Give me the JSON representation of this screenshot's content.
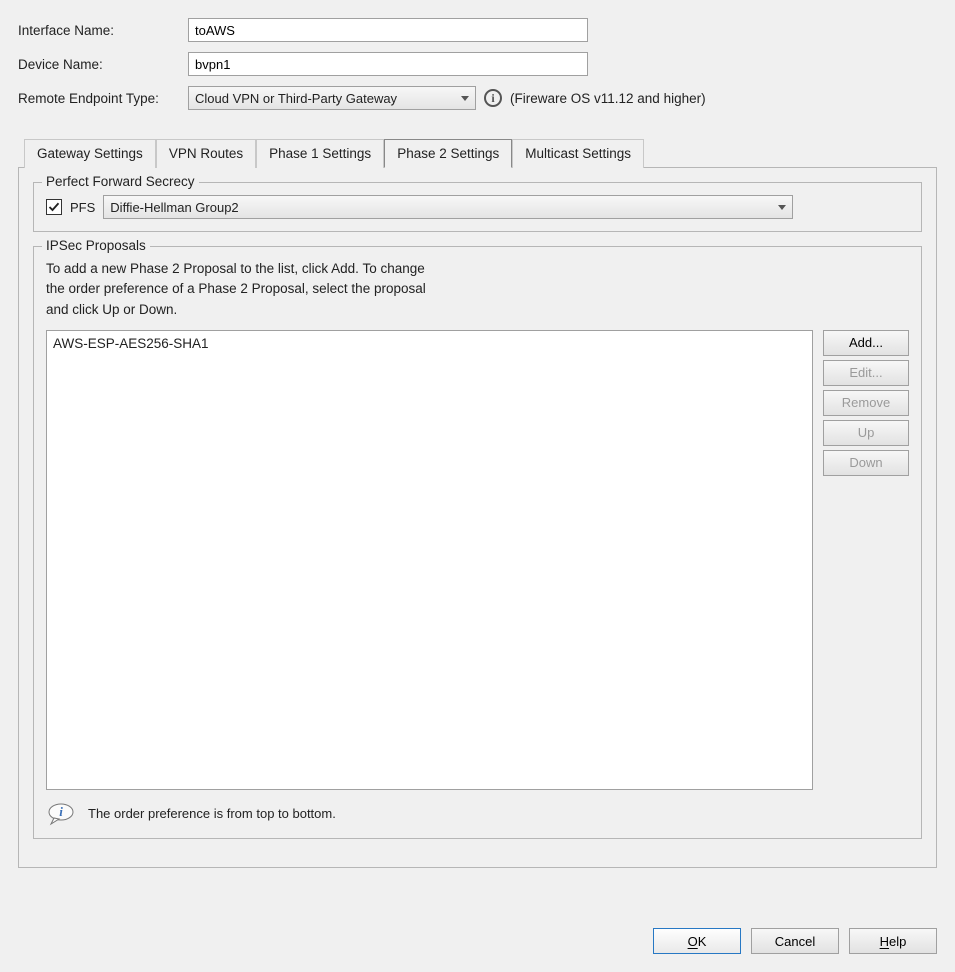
{
  "form": {
    "interface_name_label": "Interface Name:",
    "interface_name_value": "toAWS",
    "device_name_label": "Device Name:",
    "device_name_value": "bvpn1",
    "remote_endpoint_label": "Remote Endpoint Type:",
    "remote_endpoint_value": "Cloud VPN or Third-Party Gateway",
    "remote_endpoint_hint": "(Fireware OS v11.12 and higher)"
  },
  "tabs": {
    "gateway": "Gateway Settings",
    "routes": "VPN Routes",
    "phase1": "Phase 1 Settings",
    "phase2": "Phase 2 Settings",
    "multicast": "Multicast Settings"
  },
  "pfs": {
    "legend": "Perfect Forward Secrecy",
    "label": "PFS",
    "checked": true,
    "group": "Diffie-Hellman Group2"
  },
  "ipsec": {
    "legend": "IPSec Proposals",
    "desc1": "To add a new Phase 2 Proposal to the list, click Add. To change",
    "desc2": "the order preference of a Phase 2 Proposal, select the proposal",
    "desc3": "and click Up or Down.",
    "items": [
      "AWS-ESP-AES256-SHA1"
    ],
    "buttons": {
      "add": "Add...",
      "edit": "Edit...",
      "remove": "Remove",
      "up": "Up",
      "down": "Down"
    },
    "note": "The order preference is from top to bottom."
  },
  "footer": {
    "ok": "OK",
    "cancel": "Cancel",
    "help": "Help"
  }
}
